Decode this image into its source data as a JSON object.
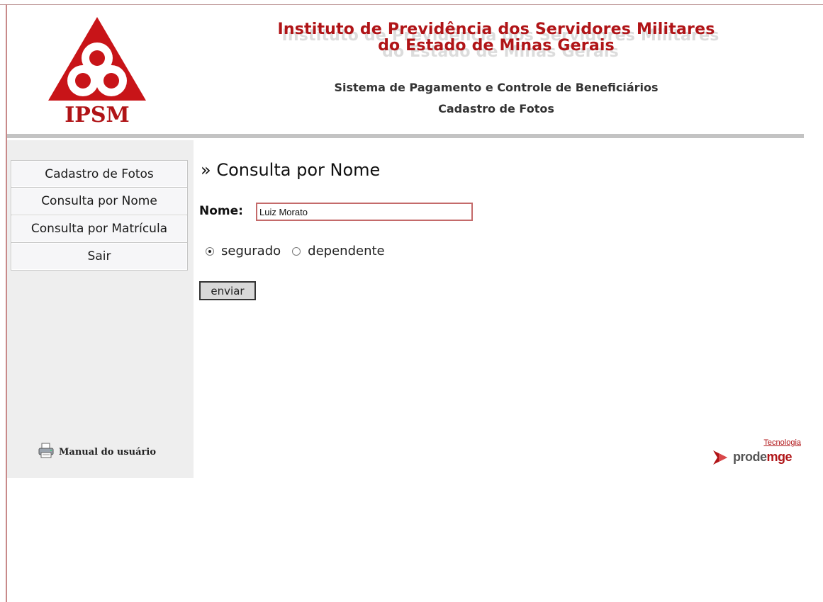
{
  "header": {
    "logo_text": "IPSM",
    "title_line1": "Instituto de Previdência dos Servidores Militares",
    "title_line2": "do Estado de Minas Gerais",
    "system_name": "Sistema de Pagamento e Controle de Beneficiários",
    "module_name": "Cadastro de Fotos"
  },
  "sidebar": {
    "items": [
      {
        "label": "Cadastro de Fotos"
      },
      {
        "label": "Consulta por Nome"
      },
      {
        "label": "Consulta por Matrícula"
      },
      {
        "label": "Sair"
      }
    ],
    "manual_label": "Manual do usuário",
    "manual_icon": "printer-icon"
  },
  "main": {
    "page_title": "» Consulta por Nome",
    "name_label": "Nome:",
    "name_value": "Luiz Morato",
    "radio_options": [
      {
        "label": "segurado",
        "checked": true
      },
      {
        "label": "dependente",
        "checked": false
      }
    ],
    "submit_label": "enviar"
  },
  "footer": {
    "brand_small": "Tecnologia",
    "brand_name_part1": "prode",
    "brand_name_part2": "mge"
  },
  "colors": {
    "brand_red": "#b01417",
    "sidebar_bg": "#eeeeee",
    "rule_gray": "#c3c3c3"
  }
}
